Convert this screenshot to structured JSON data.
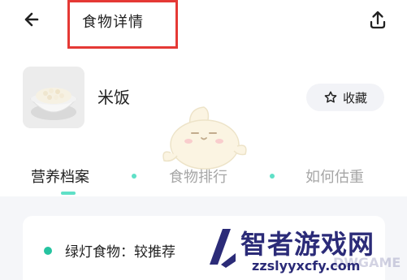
{
  "header": {
    "title": "食物详情",
    "back_icon": "back-arrow-icon",
    "share_icon": "share-icon"
  },
  "food": {
    "name": "米饭",
    "image_icon": "rice-bowl-image",
    "favorite_label": "收藏",
    "favorite_icon": "star-outline-icon"
  },
  "tabs": [
    {
      "label": "营养档案",
      "active": true
    },
    {
      "label": "食物排行",
      "active": false
    },
    {
      "label": "如何估重",
      "active": false
    }
  ],
  "card": {
    "text": "绿灯食物：较推荐"
  },
  "watermark": {
    "main": "智者游戏网",
    "sub": "zzslyyxcfy.com",
    "ghost": "DWGAME"
  },
  "colors": {
    "accent": "#5fe0c7",
    "highlight_border": "#e53935",
    "watermark": "#2b2b78"
  }
}
